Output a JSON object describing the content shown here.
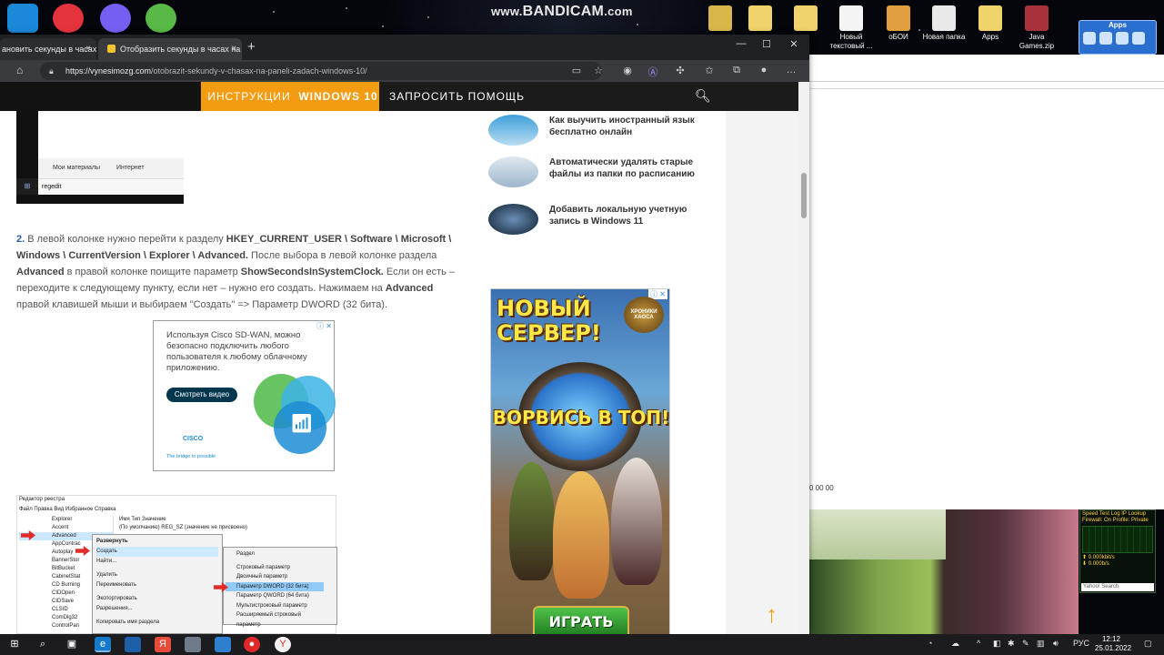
{
  "watermark": {
    "prefix": "www.",
    "brand": "BANDICAM",
    "suffix": ".com"
  },
  "desktop_icons": [
    {
      "label": "s"
    },
    {
      "label": "Новый текстовый ..."
    },
    {
      "label": "оБОИ"
    },
    {
      "label": "Новая папка"
    },
    {
      "label": "Apps"
    },
    {
      "label": "Java Games.zip"
    }
  ],
  "apps_gadget": {
    "title": "Apps"
  },
  "browser": {
    "tabs": [
      {
        "label": "ановить секунды в часах на",
        "close": "×"
      },
      {
        "label": "Отобразить секунды в часах на",
        "close": "×"
      }
    ],
    "new_tab": "+",
    "window_controls": {
      "minimize": "—",
      "maximize": "☐",
      "close": "✕"
    },
    "url_domain": "https://vynesimozg.com",
    "url_path": "/otobrazit-sekundy-v-chasax-na-paneli-zadach-windows-10/"
  },
  "site_nav": {
    "instructions": "ИНСТРУКЦИИ",
    "windows10": "WINDOWS 10",
    "help": "ЗАПРОСИТЬ ПОМОЩЬ"
  },
  "screenshot1": {
    "my_materials": "Мои материалы",
    "internet": "Интернет",
    "search_text": "regedit"
  },
  "article": {
    "step_number": "2.",
    "t1": " В левой колонке нужно перейти к разделу ",
    "path": "HKEY_CURRENT_USER \\ Software \\ Microsoft \\ Windows \\ CurrentVersion \\ Explorer \\ Advanced.",
    "t2": " После выбора в левой колонке раздела ",
    "advanced": "Advanced",
    "t3": " в правой колонке поищите параметр ",
    "param": "ShowSecondsInSystemClock.",
    "t4": " Если он есть – переходите к следующему пункту, если нет – нужно его создать. Нажимаем на ",
    "advanced2": "Advanced",
    "t5": " правой клавишей мыши и выбираем \"Создать\" => Параметр DWORD (32 бита)."
  },
  "ad_cisco": {
    "text": "Используя Cisco SD-WAN, можно безопасно подключить любого пользователя к любому облачному приложению.",
    "button": "Смотреть видео",
    "brand": "CISCO",
    "tagline": "The bridge to possible"
  },
  "regedit": {
    "title": "Редактор реестра",
    "menu": "Файл   Правка   Вид   Избранное   Справка",
    "tree": [
      "Explorer",
      "Accent",
      "Advanced",
      "AppContrac",
      "Autoplay",
      "BannerStor",
      "BitBucket",
      "CabinetStat",
      "CD Burning",
      "CIDOpen",
      "CIDSave",
      "CLSID",
      "ComDlg32",
      "ControlPan"
    ],
    "headers": "Имя                    Тип                  Значение",
    "row1": "(По умолчанию)        REG_SZ        (значение не присвоено)",
    "context": [
      "Развернуть",
      "Создать",
      "Найти...",
      "Удалить",
      "Переименовать",
      "Экспортировать",
      "Разрешения...",
      "Копировать имя раздела"
    ],
    "submenu": [
      "Раздел",
      "Строковый параметр",
      "Двоичный параметр",
      "Параметр DWORD (32 бита)",
      "Параметр QWORD (64 бита)",
      "Мультистроковый параметр",
      "Расширяемый строковый параметр"
    ]
  },
  "sidebar": [
    {
      "title": "Как выучить иностранный язык бесплатно онлайн"
    },
    {
      "title": "Автоматически удалять старые файлы из папки по расписанию"
    },
    {
      "title": "Добавить локальную учетную запись в Windows 11"
    }
  ],
  "ad_game": {
    "headline": "НОВЫЙ СЕРВЕР!",
    "logo": "ХРОНИКИ ХАОСА",
    "sub": "ВОРВИСЬ В ТОП!",
    "button": "ИГРАТЬ"
  },
  "right_window": {
    "fragment": "0 00 00"
  },
  "netmeter": {
    "line1": "Speed Test   Log   IP Lookup",
    "line2": "Firewall: On   Profile: Private",
    "in_speed": "0.000kbit/s",
    "out_speed": "0.000b/s",
    "search": "Yahoo! Search"
  },
  "taskbar": {
    "lang": "РУС",
    "time": "12:12",
    "date": "25.01.2022"
  }
}
